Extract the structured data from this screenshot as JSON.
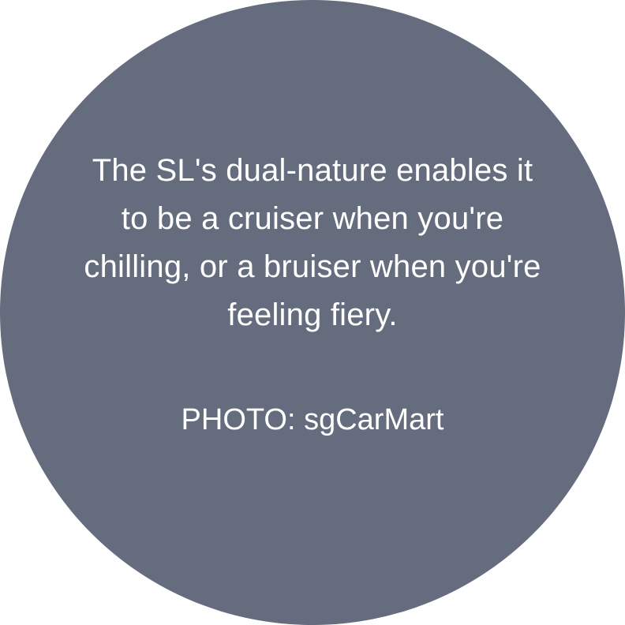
{
  "quote": {
    "caption": "The SL's dual-nature enables it to be a cruiser when you're chilling, or a bruiser when you're feeling fiery.",
    "credit": "PHOTO: sgCarMart"
  },
  "colors": {
    "circle": "#646c7d",
    "text": "#ffffff",
    "background": "#ffffff"
  }
}
